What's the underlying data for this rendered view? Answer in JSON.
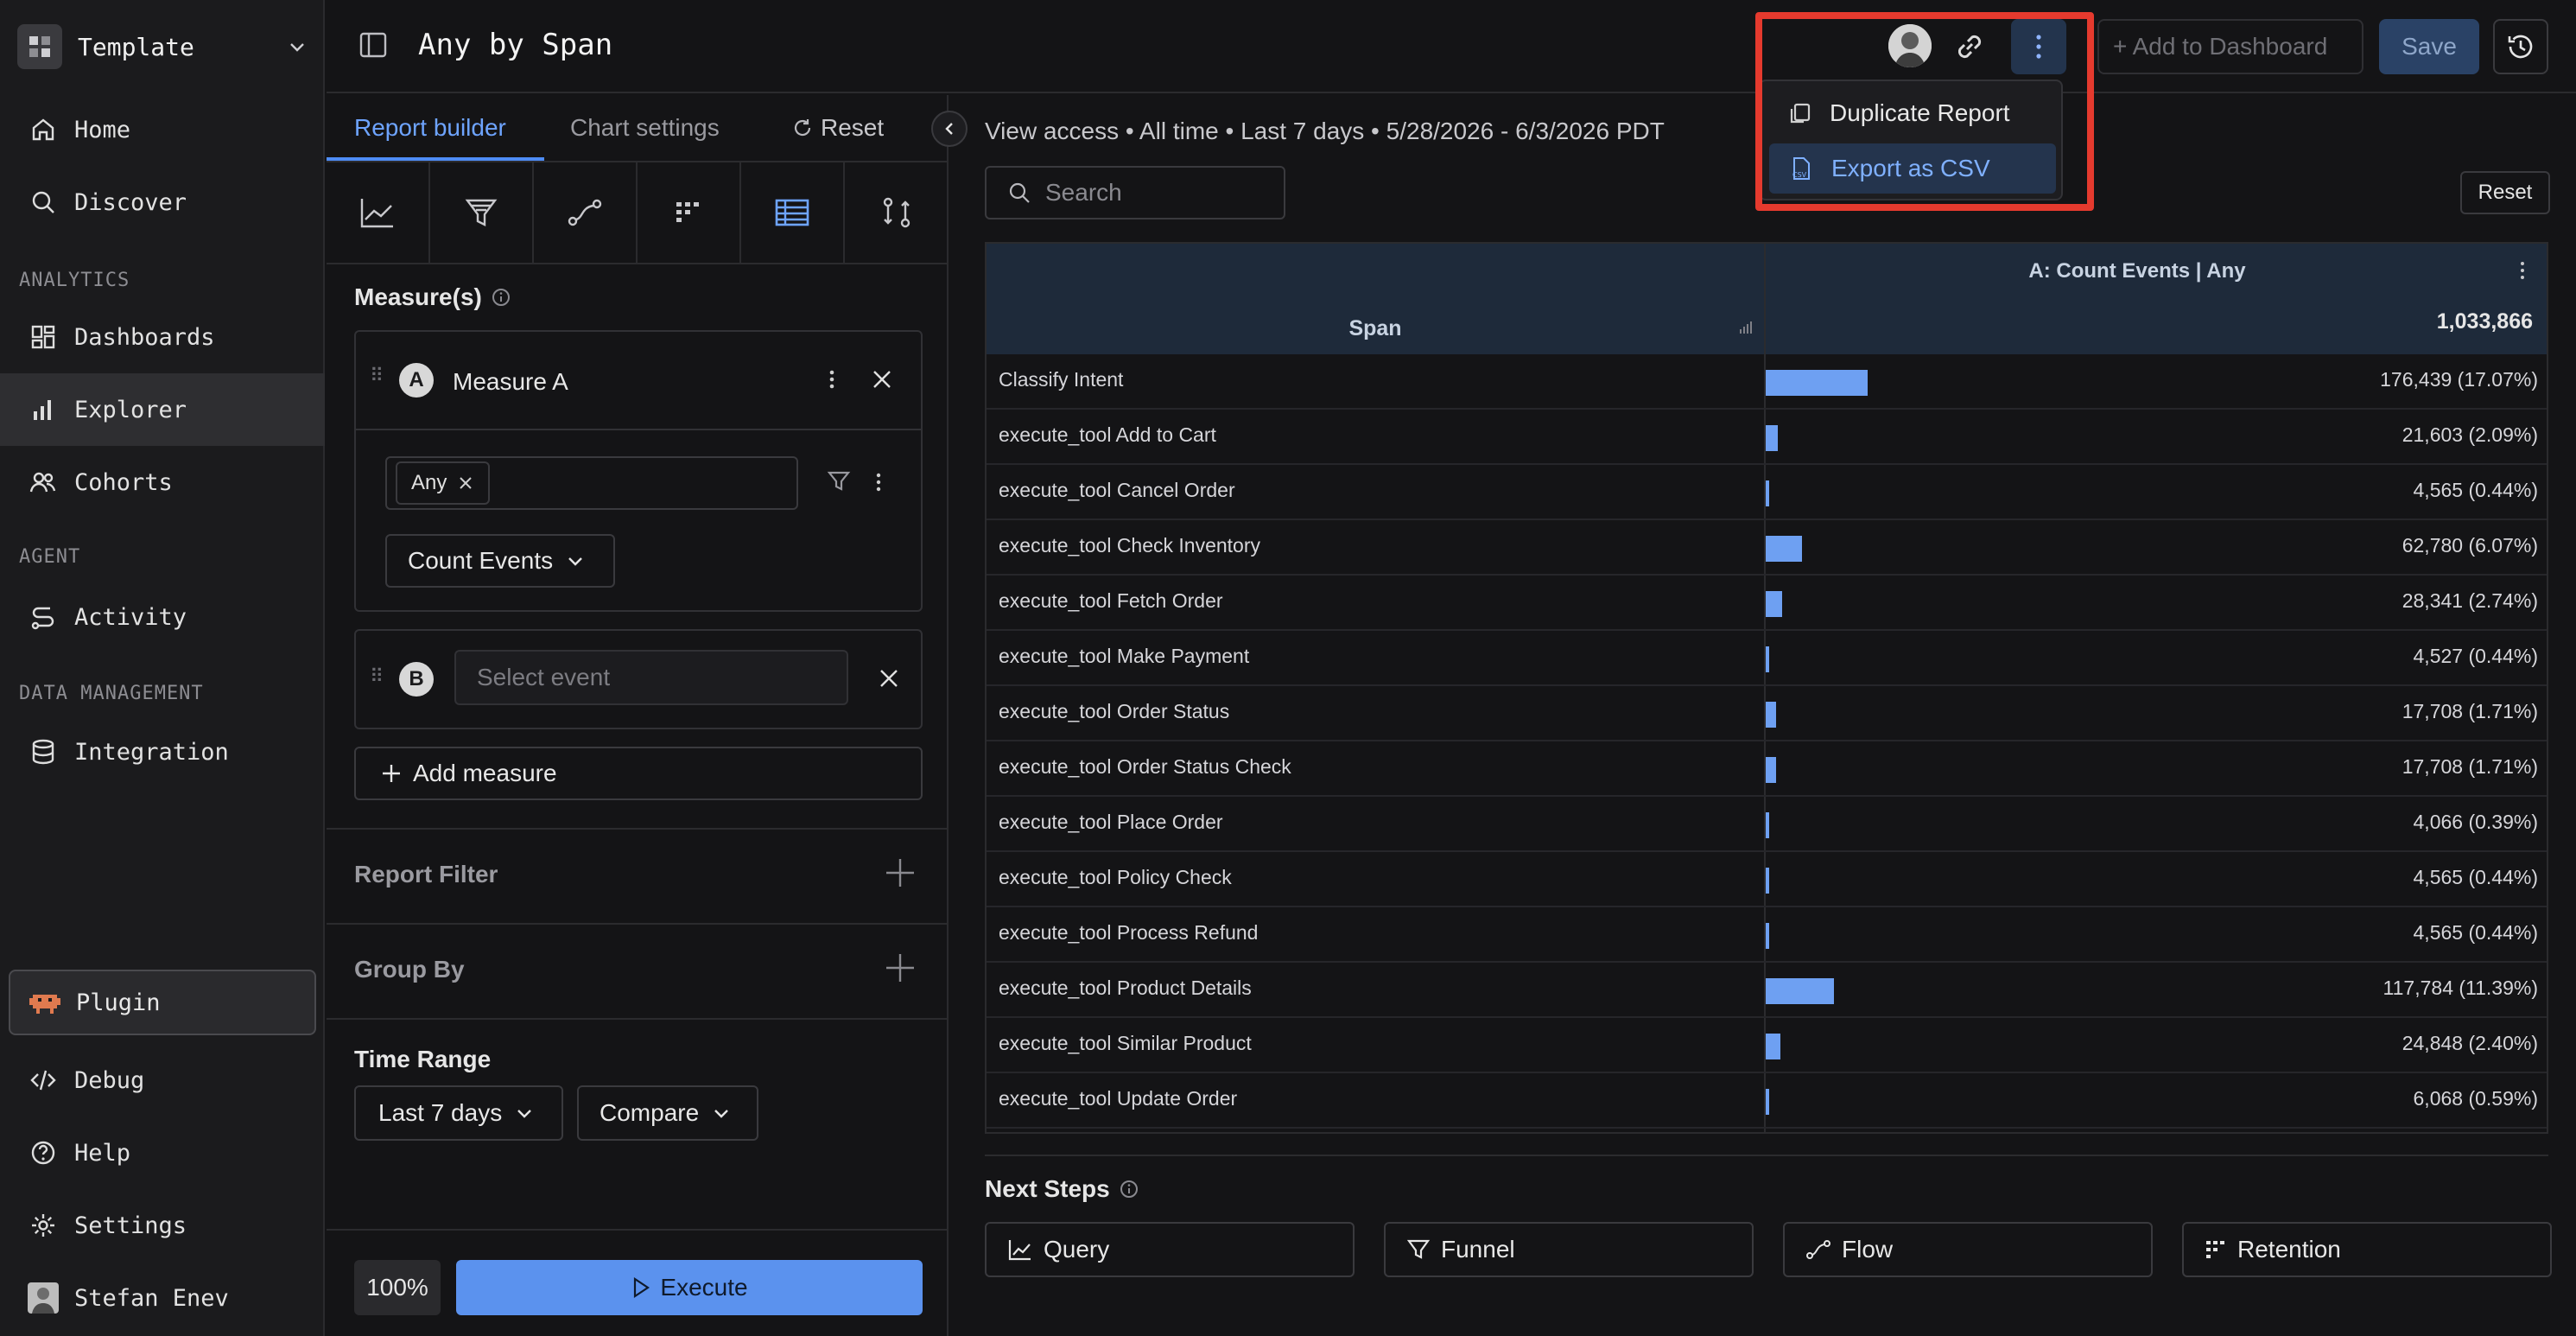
{
  "workspace": {
    "name": "Template"
  },
  "nav": {
    "home": "Home",
    "discover": "Discover",
    "section_analytics": "ANALYTICS",
    "dashboards": "Dashboards",
    "explorer": "Explorer",
    "cohorts": "Cohorts",
    "section_agent": "AGENT",
    "activity": "Activity",
    "section_data": "DATA MANAGEMENT",
    "integration": "Integration",
    "plugin": "Plugin",
    "debug": "Debug",
    "help": "Help",
    "settings": "Settings",
    "user": "Stefan Enev"
  },
  "header": {
    "title": "Any by Span",
    "add_to_dashboard": "+ Add to Dashboard",
    "save": "Save"
  },
  "menu": {
    "duplicate": "Duplicate Report",
    "export_csv": "Export as CSV"
  },
  "builder": {
    "tab_report": "Report builder",
    "tab_chart": "Chart settings",
    "reset": "Reset",
    "measures_title": "Measure(s)",
    "measure_a_letter": "A",
    "measure_a_label": "Measure A",
    "any_chip": "Any",
    "count_events": "Count Events",
    "measure_b_letter": "B",
    "select_event_placeholder": "Select event",
    "add_measure": "Add measure",
    "report_filter": "Report Filter",
    "group_by": "Group By",
    "time_range_title": "Time Range",
    "time_range_value": "Last 7 days",
    "compare": "Compare",
    "zoom": "100%",
    "execute": "Execute"
  },
  "results": {
    "view_access": "View access • All time • Last 7 days • 5/28/2026 - 6/3/2026 PDT",
    "search_placeholder": "Search",
    "reset": "Reset",
    "col_measure": "A: Count Events | Any",
    "col_span": "Span",
    "total": "1,033,866",
    "rows": [
      {
        "name": "Classify Intent",
        "value": "176,439 (17.07%)",
        "pct": 17.07
      },
      {
        "name": "execute_tool Add to Cart",
        "value": "21,603 (2.09%)",
        "pct": 2.09
      },
      {
        "name": "execute_tool Cancel Order",
        "value": "4,565 (0.44%)",
        "pct": 0.44
      },
      {
        "name": "execute_tool Check Inventory",
        "value": "62,780 (6.07%)",
        "pct": 6.07
      },
      {
        "name": "execute_tool Fetch Order",
        "value": "28,341 (2.74%)",
        "pct": 2.74
      },
      {
        "name": "execute_tool Make Payment",
        "value": "4,527 (0.44%)",
        "pct": 0.44
      },
      {
        "name": "execute_tool Order Status",
        "value": "17,708 (1.71%)",
        "pct": 1.71
      },
      {
        "name": "execute_tool Order Status Check",
        "value": "17,708 (1.71%)",
        "pct": 1.71
      },
      {
        "name": "execute_tool Place Order",
        "value": "4,066 (0.39%)",
        "pct": 0.39
      },
      {
        "name": "execute_tool Policy Check",
        "value": "4,565 (0.44%)",
        "pct": 0.44
      },
      {
        "name": "execute_tool Process Refund",
        "value": "4,565 (0.44%)",
        "pct": 0.44
      },
      {
        "name": "execute_tool Product Details",
        "value": "117,784 (11.39%)",
        "pct": 11.39
      },
      {
        "name": "execute_tool Similar Product",
        "value": "24,848 (2.40%)",
        "pct": 2.4
      },
      {
        "name": "execute_tool Update Order",
        "value": "6,068 (0.59%)",
        "pct": 0.59
      }
    ],
    "next_steps": "Next Steps",
    "ns_query": "Query",
    "ns_funnel": "Funnel",
    "ns_flow": "Flow",
    "ns_retention": "Retention"
  },
  "colors": {
    "accent": "#5b92ee",
    "bar": "#6ea0f2",
    "highlight": "#e53a2e"
  }
}
